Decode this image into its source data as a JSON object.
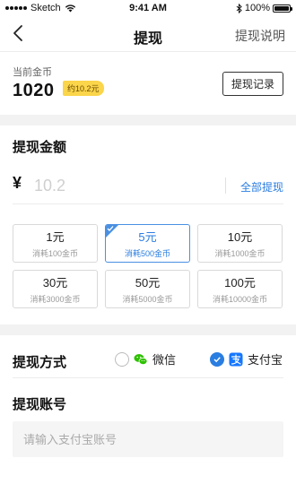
{
  "status_bar": {
    "carrier": "Sketch",
    "time": "9:41 AM",
    "battery": "100%"
  },
  "nav": {
    "title": "提现",
    "help": "提现说明"
  },
  "balance": {
    "label": "当前金币",
    "value": "1020",
    "badge": "约10.2元",
    "record_button": "提现记录"
  },
  "amount": {
    "title": "提现金额",
    "currency": "¥",
    "value": "",
    "placeholder": "10.2",
    "all_button": "全部提现"
  },
  "options": [
    {
      "amount": "1元",
      "cost": "消耗100金币",
      "selected": false
    },
    {
      "amount": "5元",
      "cost": "消耗500金币",
      "selected": true
    },
    {
      "amount": "10元",
      "cost": "消耗1000金币",
      "selected": false
    },
    {
      "amount": "30元",
      "cost": "消耗3000金币",
      "selected": false
    },
    {
      "amount": "50元",
      "cost": "消耗5000金币",
      "selected": false
    },
    {
      "amount": "100元",
      "cost": "消耗10000金币",
      "selected": false
    }
  ],
  "payment": {
    "label": "提现方式",
    "methods": [
      {
        "name": "微信",
        "icon": "wechat-icon",
        "selected": false
      },
      {
        "name": "支付宝",
        "icon": "alipay-icon",
        "selected": true
      }
    ]
  },
  "account": {
    "title": "提现账号",
    "value": "",
    "placeholder": "请输入支付宝账号"
  },
  "colors": {
    "accent": "#2a7de1",
    "badge": "#fbd54a",
    "wechat": "#2dc100",
    "alipay": "#1677ff"
  }
}
